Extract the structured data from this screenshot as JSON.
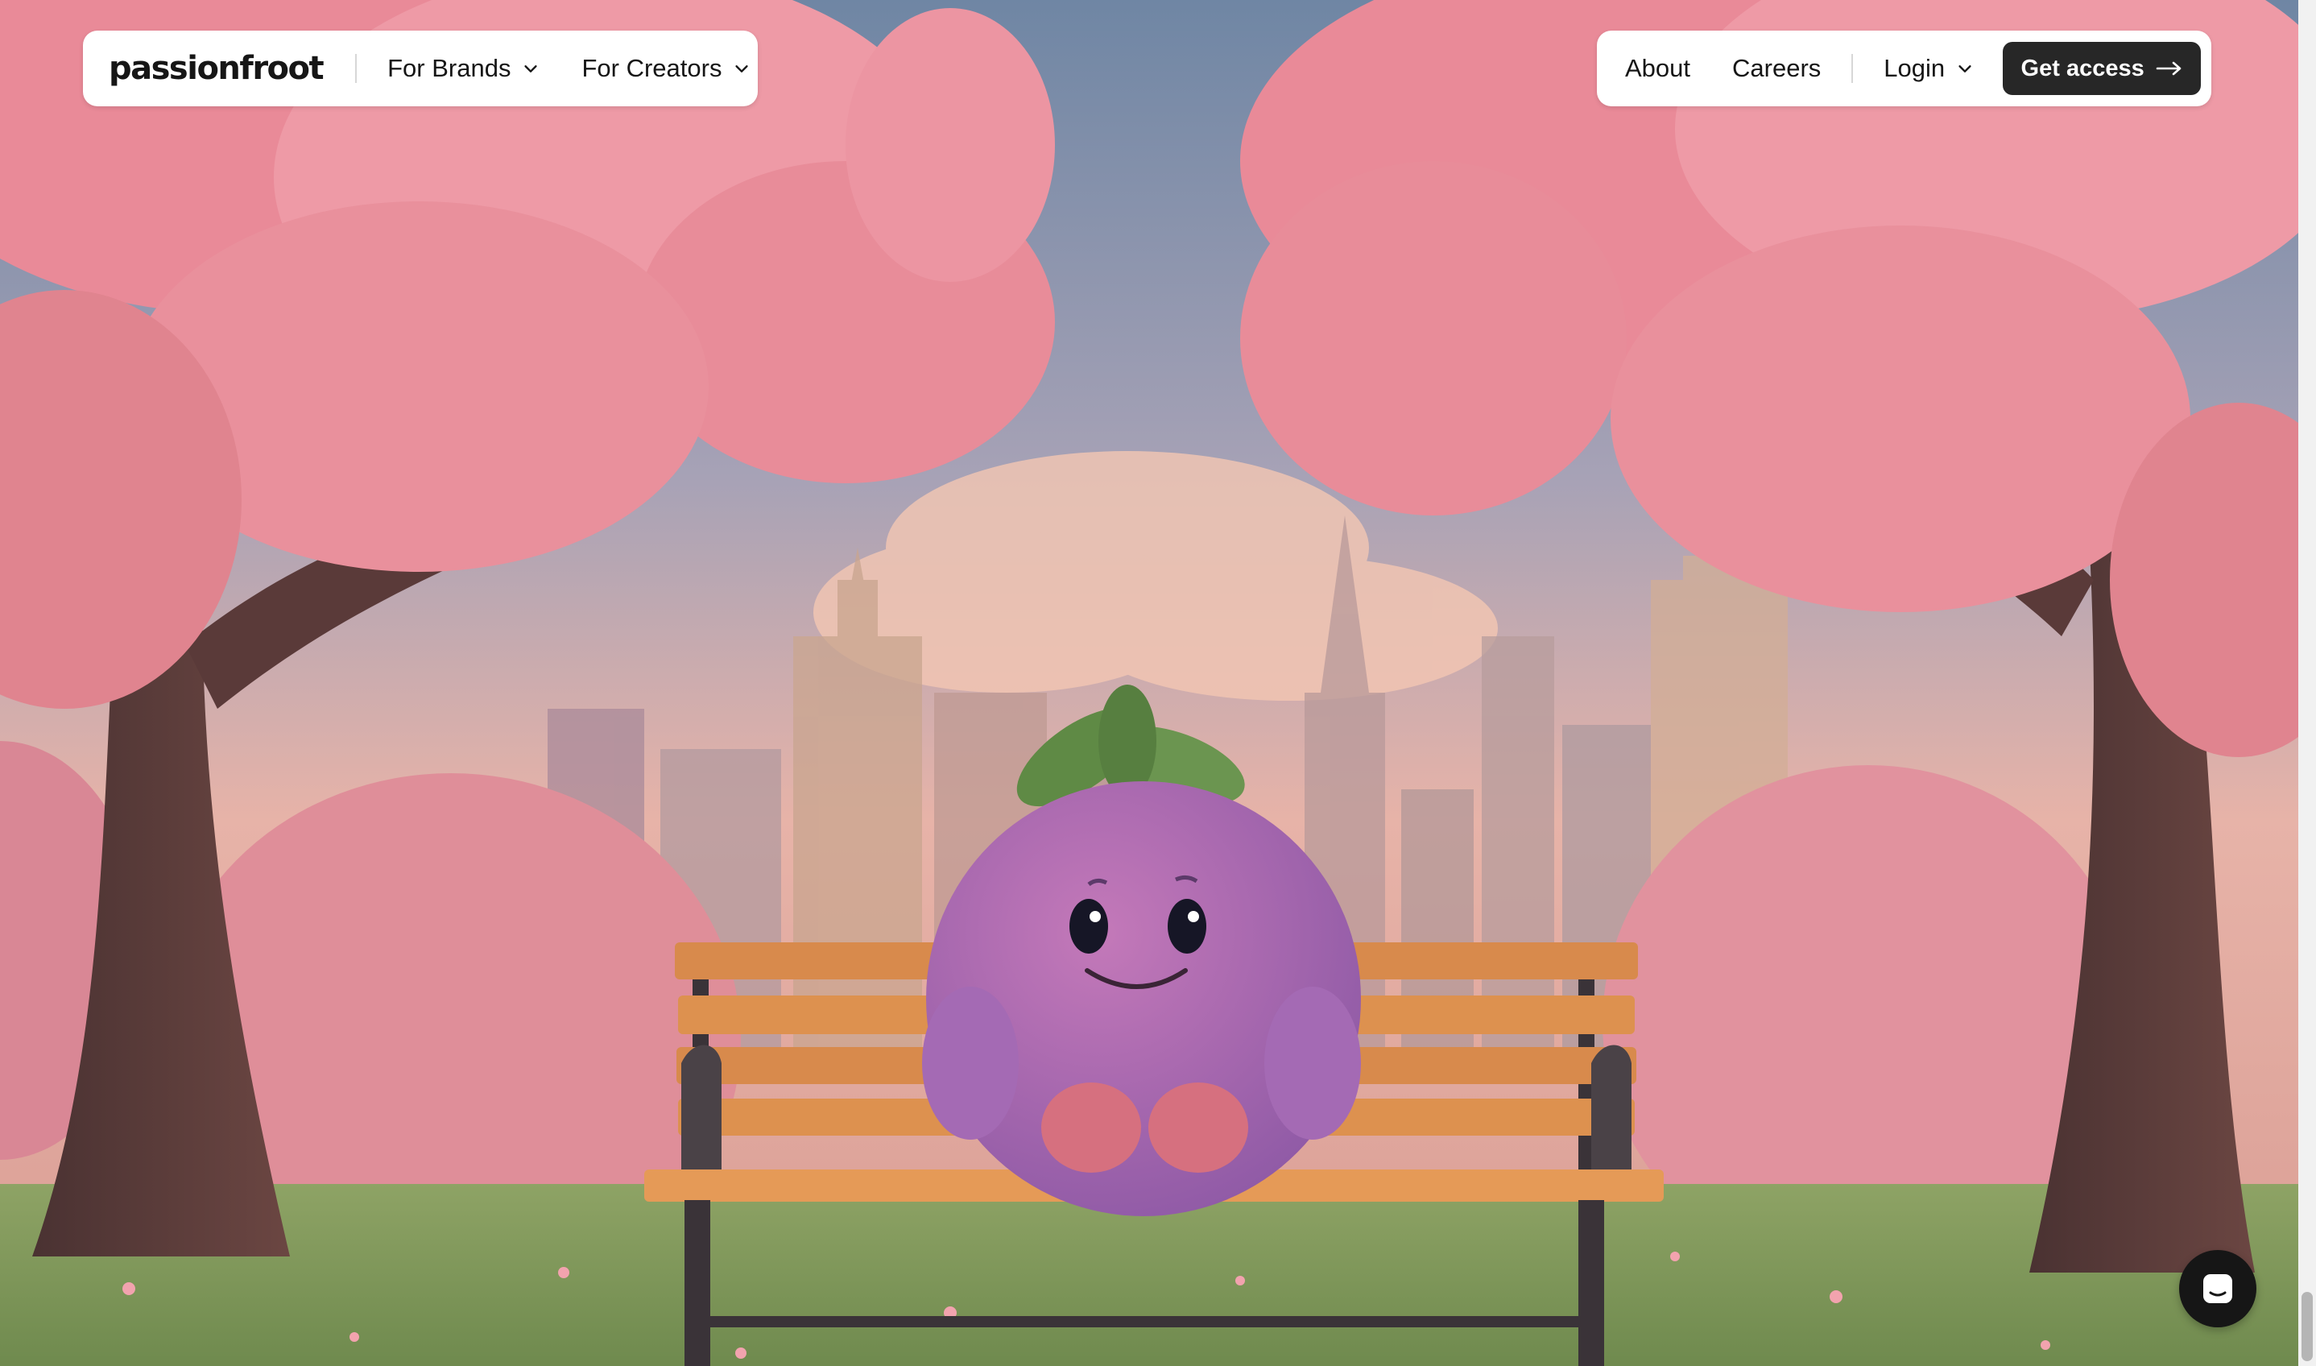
{
  "header": {
    "logo_text": "passionfroot",
    "nav_left": [
      {
        "label": "For Brands"
      },
      {
        "label": "For Creators"
      }
    ],
    "nav_right": {
      "about_label": "About",
      "careers_label": "Careers",
      "login_label": "Login",
      "cta_label": "Get access"
    }
  },
  "hero": {
    "icons": [
      "chevron-down-icon",
      "arrow-right-icon",
      "chat-icon"
    ]
  },
  "colors": {
    "cta_background": "#272727",
    "nav_background": "#ffffff",
    "blossom_pink": "#e98a98",
    "mascot_purple": "#a66ab6"
  }
}
